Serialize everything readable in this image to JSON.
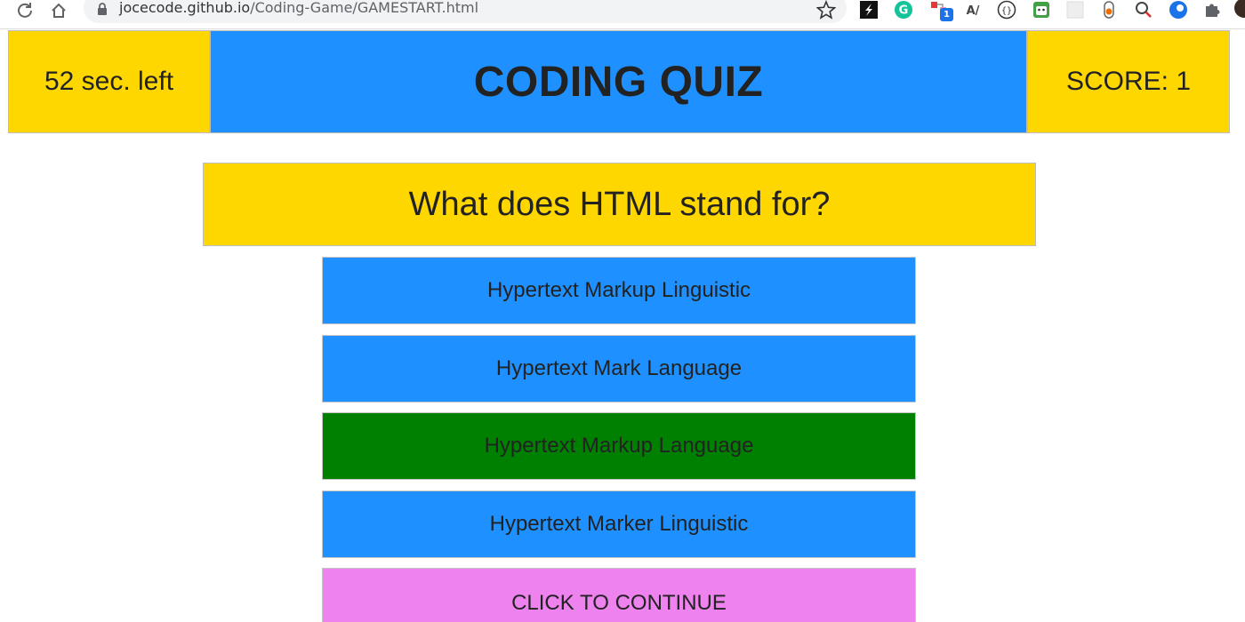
{
  "browser": {
    "url_host": "jocecode.github.io",
    "url_path": "/Coding-Game/GAMESTART.html",
    "extension_badge": "1",
    "icons": [
      "reload-icon",
      "home-icon",
      "lock-icon",
      "star-icon",
      "extension-icons",
      "avatar"
    ]
  },
  "header": {
    "timer": "52 sec. left",
    "title": "CODING QUIZ",
    "score": "SCORE: 1"
  },
  "question": {
    "text": "What does HTML stand for?"
  },
  "answers": [
    {
      "label": "Hypertext Markup Linguistic",
      "state": "default"
    },
    {
      "label": "Hypertext Mark Language",
      "state": "default"
    },
    {
      "label": "Hypertext Markup Language",
      "state": "correct"
    },
    {
      "label": "Hypertext Marker Linguistic",
      "state": "default"
    }
  ],
  "continue_button": {
    "label": "CLICK TO CONTINUE"
  },
  "colors": {
    "yellow": "#ffd700",
    "blue": "#1e90ff",
    "green": "#008000",
    "violet": "#ee82ee"
  }
}
